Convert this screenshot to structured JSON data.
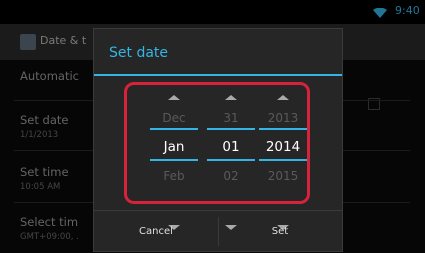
{
  "status_bar": {
    "time": "9:40",
    "wifi_icon": "wifi-icon"
  },
  "background": {
    "title": "Date & t",
    "settings": [
      {
        "title": "Automatic",
        "sub": ""
      },
      {
        "title": "Set date",
        "sub": "1/1/2013"
      },
      {
        "title": "Set time",
        "sub": "10:05 AM"
      },
      {
        "title": "Select tim",
        "sub": "GMT+09:00, ."
      }
    ]
  },
  "dialog": {
    "title": "Set date",
    "pickers": [
      {
        "prev": "Dec",
        "current": "Jan",
        "next": "Feb"
      },
      {
        "prev": "31",
        "current": "01",
        "next": "02"
      },
      {
        "prev": "2013",
        "current": "2014",
        "next": "2015"
      }
    ],
    "cancel_label": "Cancel",
    "set_label": "Set"
  },
  "colors": {
    "accent": "#33b5e5",
    "highlight": "#d6223b"
  }
}
